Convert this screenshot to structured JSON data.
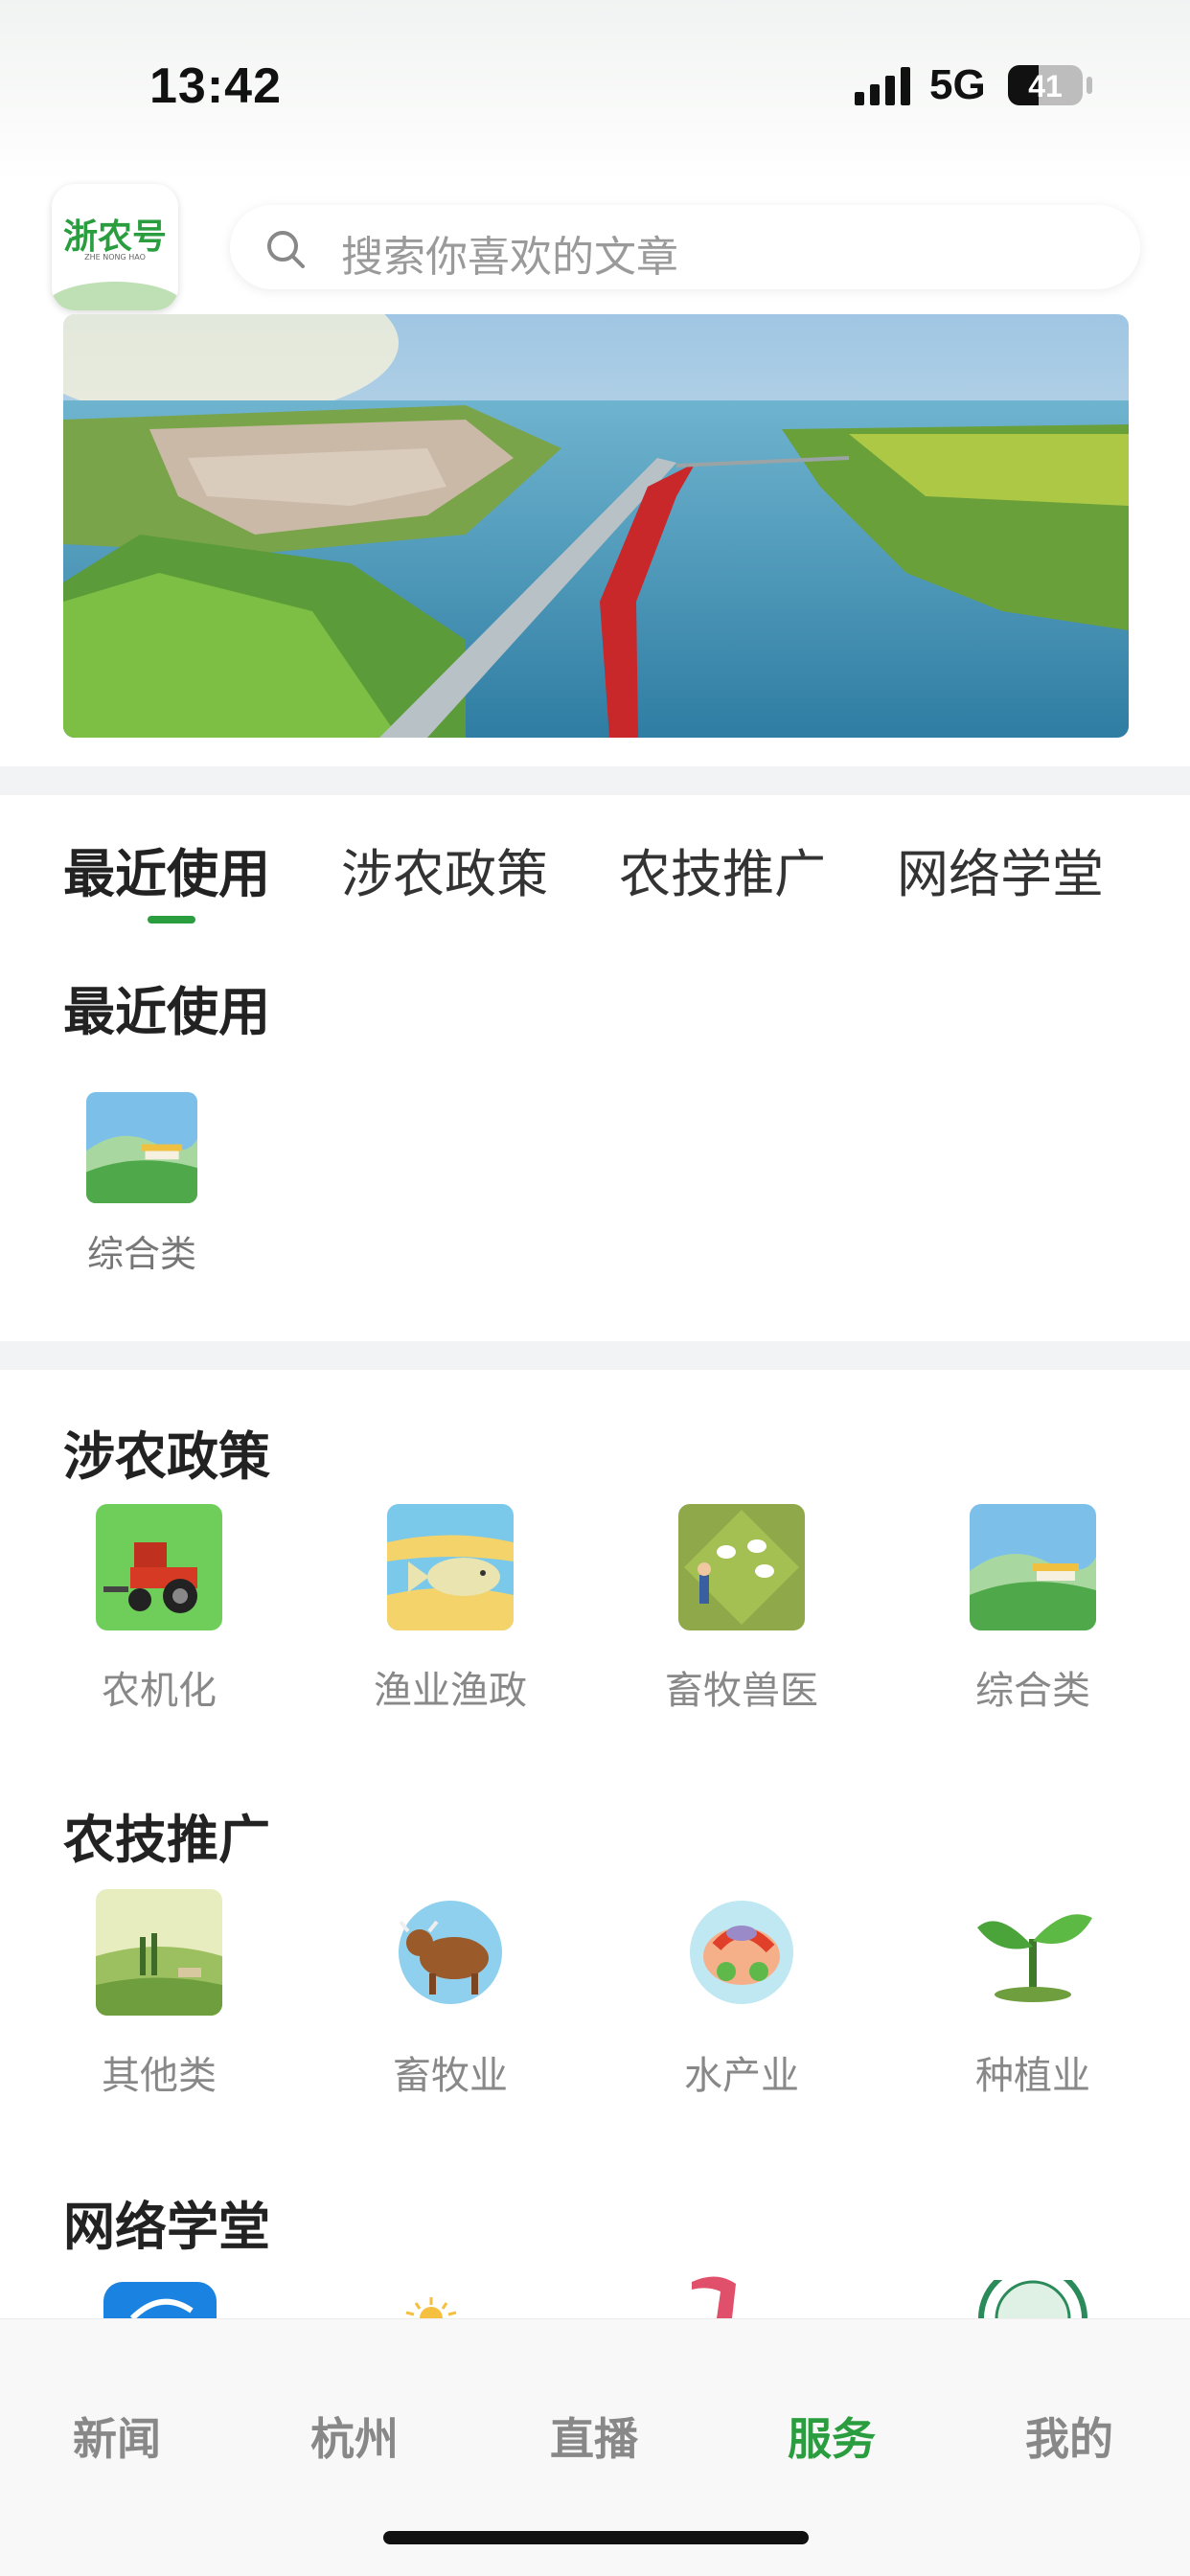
{
  "status_bar": {
    "time": "13:42",
    "network": "5G",
    "battery": "41",
    "battery_level": 0.41
  },
  "header": {
    "logo_text": "浙农号",
    "logo_sub": "ZHE NONG HAO",
    "search_placeholder": "搜索你喜欢的文章"
  },
  "tabs": [
    {
      "label": "最近使用",
      "active": true
    },
    {
      "label": "涉农政策",
      "active": false
    },
    {
      "label": "农技推广",
      "active": false
    },
    {
      "label": "网络学堂",
      "active": false
    }
  ],
  "sections": {
    "recent": {
      "title": "最近使用",
      "items": [
        {
          "label": "综合类",
          "icon": "landscape-icon"
        }
      ]
    },
    "policy": {
      "title": "涉农政策",
      "items": [
        {
          "label": "农机化",
          "icon": "tractor-icon"
        },
        {
          "label": "渔业渔政",
          "icon": "fish-icon"
        },
        {
          "label": "畜牧兽医",
          "icon": "sheep-icon"
        },
        {
          "label": "综合类",
          "icon": "landscape-icon"
        }
      ]
    },
    "tech": {
      "title": "农技推广",
      "items": [
        {
          "label": "其他类",
          "icon": "field-icon"
        },
        {
          "label": "畜牧业",
          "icon": "cattle-icon"
        },
        {
          "label": "水产业",
          "icon": "seafood-icon"
        },
        {
          "label": "种植业",
          "icon": "sprout-icon"
        }
      ]
    },
    "school": {
      "title": "网络学堂"
    }
  },
  "bottom_nav": [
    {
      "label": "新闻",
      "active": false
    },
    {
      "label": "杭州",
      "active": false
    },
    {
      "label": "直播",
      "active": false
    },
    {
      "label": "服务",
      "active": true
    },
    {
      "label": "我的",
      "active": false
    }
  ],
  "colors": {
    "accent": "#2a9d3f",
    "muted_text": "#888888"
  }
}
